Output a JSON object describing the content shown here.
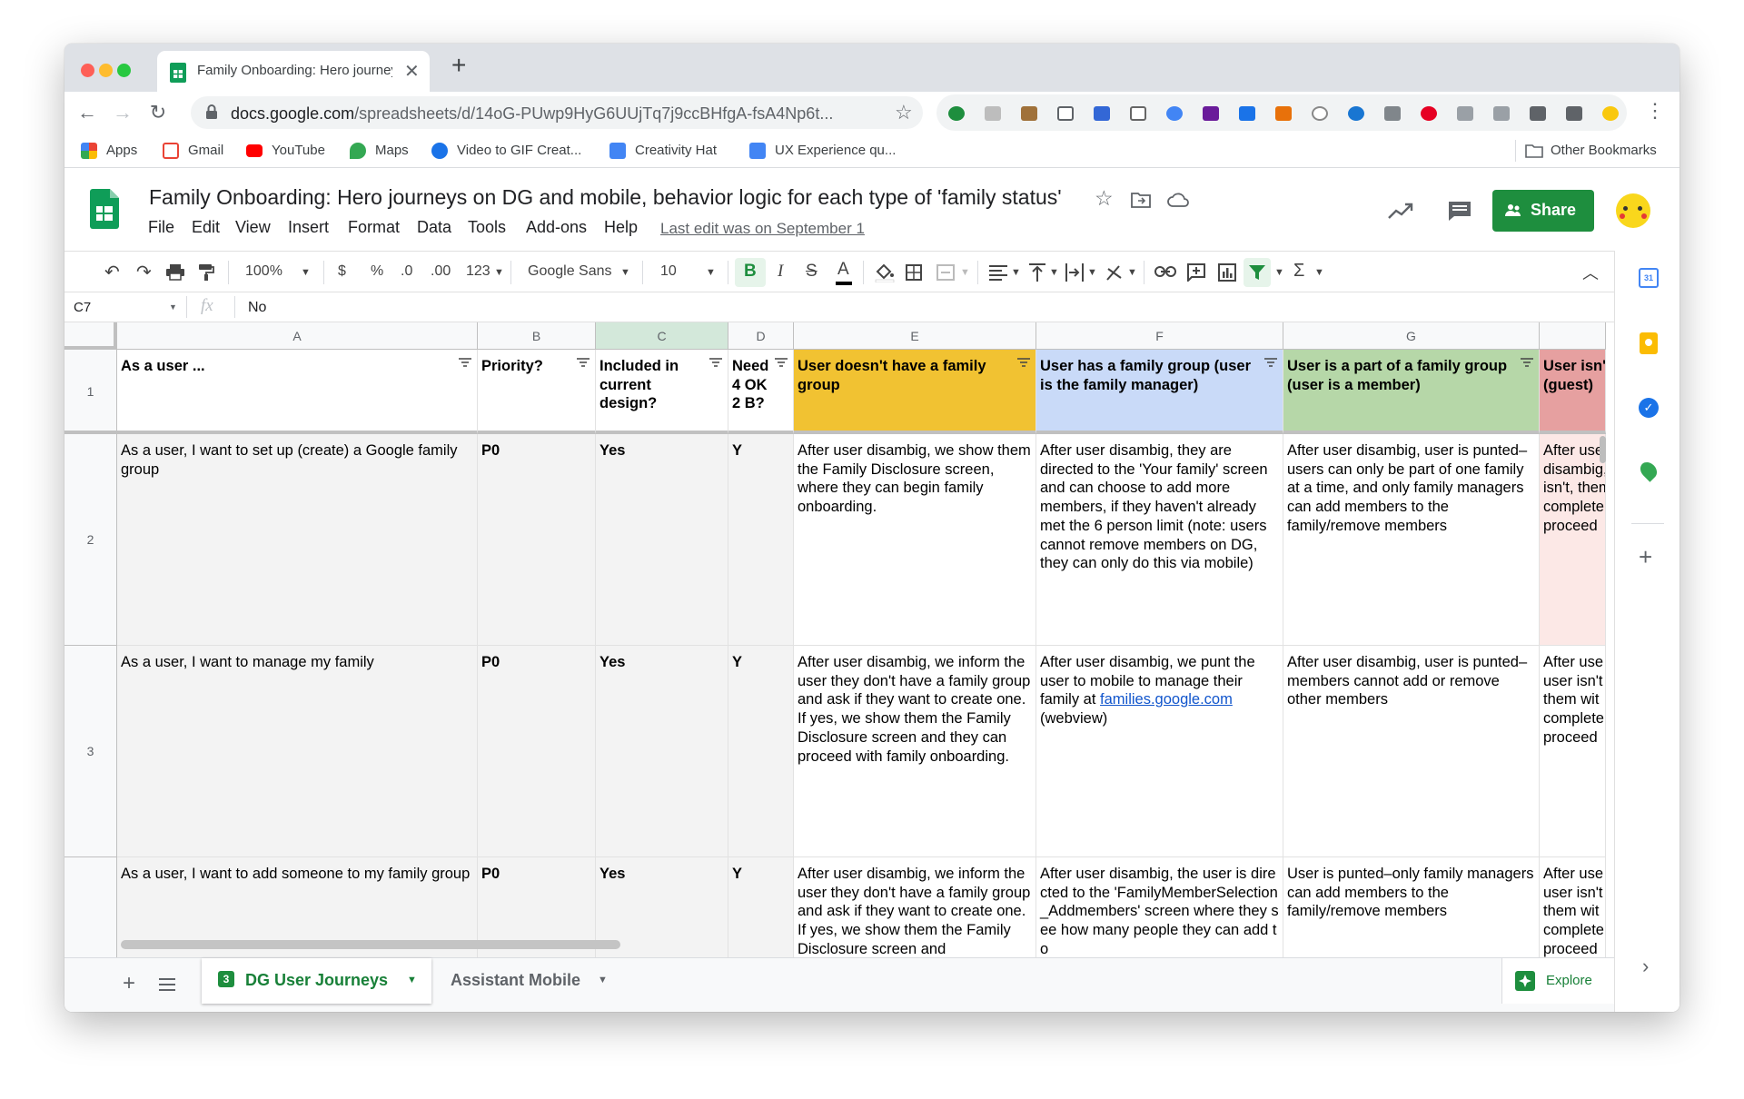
{
  "browser": {
    "tab_title": "Family Onboarding: Hero journeys",
    "new_tab": "+",
    "url_host": "docs.google.com",
    "url_path": "/spreadsheets/d/14oG-PUwp9HyG6UUjTq7j9ccBHfgA-fsA4Np6t..."
  },
  "bookmarks": {
    "items": [
      "Apps",
      "Gmail",
      "YouTube",
      "Maps",
      "Video to GIF Creat...",
      "Creativity Hat",
      "UX Experience qu..."
    ],
    "other": "Other Bookmarks"
  },
  "doc": {
    "title": "Family Onboarding: Hero journeys on DG and mobile, behavior logic for each type of 'family status'",
    "menu": [
      "File",
      "Edit",
      "View",
      "Insert",
      "Format",
      "Data",
      "Tools",
      "Add-ons",
      "Help"
    ],
    "last_edit": "Last edit was on September 1",
    "share": "Share"
  },
  "toolbar": {
    "zoom": "100%",
    "currency": "$",
    "percent": "%",
    "dec_less": ".0",
    "dec_more": ".00",
    "format_more": "123",
    "font": "Google Sans",
    "font_size": "10"
  },
  "formula_bar": {
    "cell_ref": "C7",
    "fx": "fx",
    "value": "No"
  },
  "columns": [
    "A",
    "B",
    "C",
    "D",
    "E",
    "F",
    "G"
  ],
  "rows": [
    "1",
    "2",
    "3"
  ],
  "header_row": {
    "a": "As a user ...",
    "b": "Priority?",
    "c": "Included in current design?",
    "d": "Need 4 OK2 B?",
    "e": "User doesn't have a family group",
    "f": "User has a family group (user is the family manager)",
    "g": "User is a part of a family group (user is a member)",
    "h": "User isn't (guest)"
  },
  "row2": {
    "a": "As a user, I want to set up (create) a Google family group",
    "b": "P0",
    "c": "Yes",
    "d": "Y",
    "e": "After user disambig, we show them the Family Disclosure screen, where they can begin family onboarding.",
    "f": "After user disambig, they are directed to the 'Your family' screen and can choose to add more members, if they haven't already met the 6 person limit (note: users cannot remove members on DG, they can only do this via mobile)",
    "g": "After user disambig, user is punted–users can only be part of one family at a time, and only family managers can add members to the family/remove members",
    "h": "After user disambig, user isn't, them with complete, proceed"
  },
  "row3": {
    "a": "As a user, I want to manage my family",
    "b": "P0",
    "c": "Yes",
    "d": "Y",
    "e": "After user disambig, we inform the user they don't have a family group and ask if they want to create one. If yes, we show them the Family Disclosure screen and they can proceed with family onboarding.",
    "f_pre": "After user disambig, we punt the user to mobile to manage their family at ",
    "f_link": "families.google.com",
    "f_post": " (webview)",
    "g": "After user disambig, user is punted–members cannot add or remove other members",
    "h": "After use user isn't them wit complete proceed"
  },
  "row4": {
    "a": "As a user, I want to add someone to my family group",
    "b": "P0",
    "c": "Yes",
    "d": "Y",
    "e": "After user disambig, we inform the user they don't have a family group and ask if they want to create one. If yes, we show them the Family Disclosure screen and",
    "f": "After user disambig, the user is directed to the 'FamilyMemberSelection_Addmembers' screen where they see how many people they can add to",
    "g": "User is punted–only family managers can add members to the family/remove members",
    "h": "After use user isn't them wit complete proceed"
  },
  "sheets": {
    "tab1_count": "3",
    "tab1": "DG User Journeys",
    "tab2": "Assistant Mobile",
    "explore": "Explore"
  },
  "colors": {
    "col_e": "#f1c232",
    "col_f": "#c9daf8",
    "col_g": "#b6d7a8",
    "col_h": "#e6a0a0",
    "share": "#1e8e3e"
  }
}
